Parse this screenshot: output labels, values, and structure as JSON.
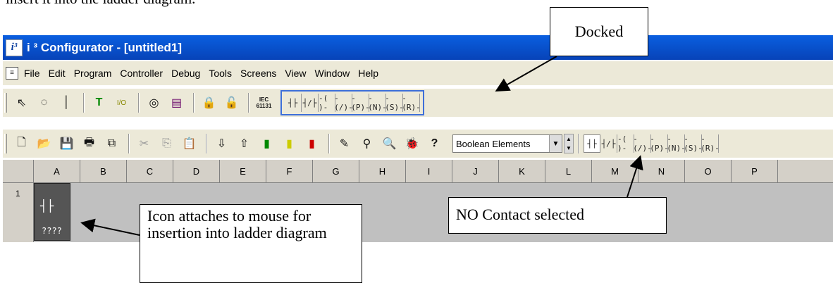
{
  "doc_text": "insert it into the ladder diagram.",
  "window": {
    "title": "i ³ Configurator - [untitled1]"
  },
  "menu": [
    "File",
    "Edit",
    "Program",
    "Controller",
    "Debug",
    "Tools",
    "Screens",
    "View",
    "Window",
    "Help"
  ],
  "toolbar1": {
    "buttons": [
      "pointer",
      "lasso",
      "line",
      "T",
      "I/O",
      "settings",
      "sheet",
      "lock",
      "unlock",
      "IEC 61131"
    ],
    "ladder": [
      "┤├",
      "┤/├",
      "-( )-",
      "-(/)-",
      "-(P)-",
      "-(N)-",
      "-(S)-",
      "-(R)-"
    ]
  },
  "toolbar2": {
    "combo_value": "Boolean Elements",
    "ladder": [
      "┤├",
      "┤/├",
      "-( )-",
      "-(/)-",
      "-(P)-",
      "-(N)-",
      "-(S)-",
      "-(R)-"
    ]
  },
  "columns": [
    "A",
    "B",
    "C",
    "D",
    "E",
    "F",
    "G",
    "H",
    "I",
    "J",
    "K",
    "L",
    "M",
    "N",
    "O",
    "P"
  ],
  "grid": {
    "row": "1",
    "cell_symbol": "┤├",
    "cell_label": "????"
  },
  "callouts": {
    "docked": "Docked",
    "no_contact": "NO Contact selected",
    "icon": "Icon attaches to mouse for insertion into ladder diagram"
  }
}
